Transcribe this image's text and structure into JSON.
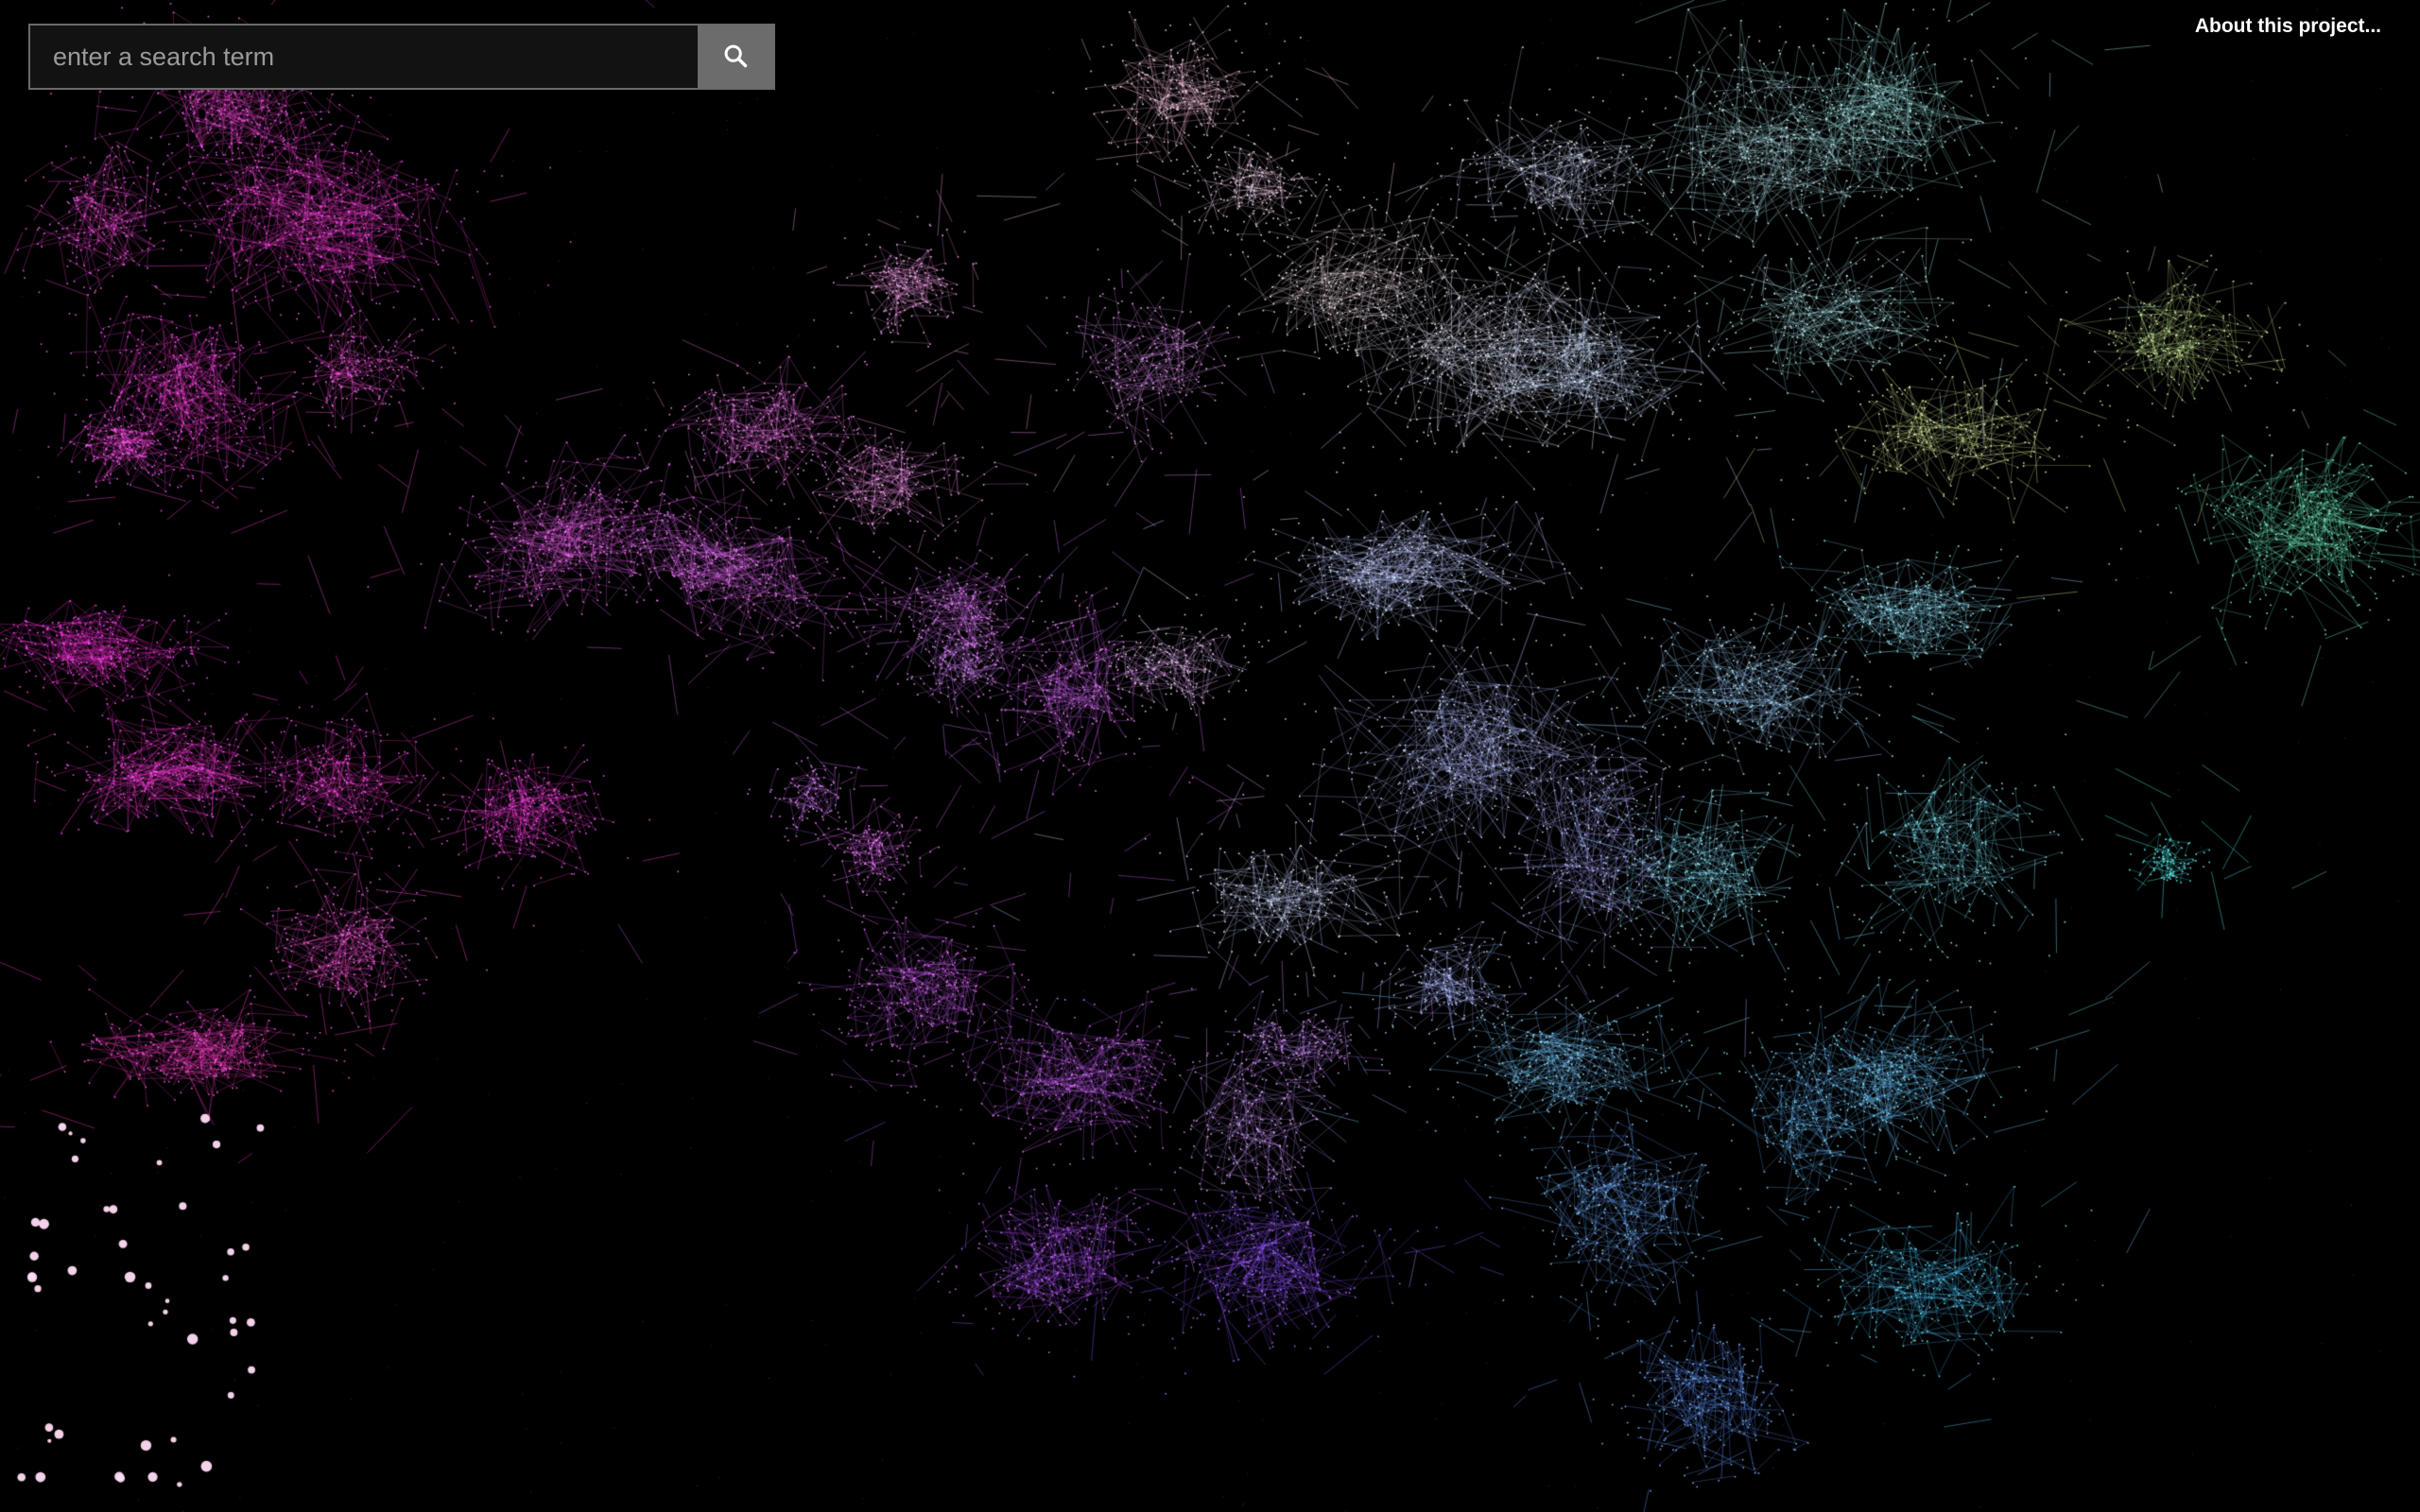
{
  "search": {
    "placeholder": "enter a search term",
    "value": "",
    "button_icon": "search-icon"
  },
  "header": {
    "about_link": "About this project..."
  },
  "visualization": {
    "background": "#000000",
    "palette": [
      "#ff3cdc",
      "#e060ff",
      "#b070ff",
      "#9aa8ff",
      "#c8d8ff",
      "#70e0ff",
      "#5ad8c0",
      "#6ef0a8",
      "#c8d890",
      "#ff4f9a"
    ]
  }
}
